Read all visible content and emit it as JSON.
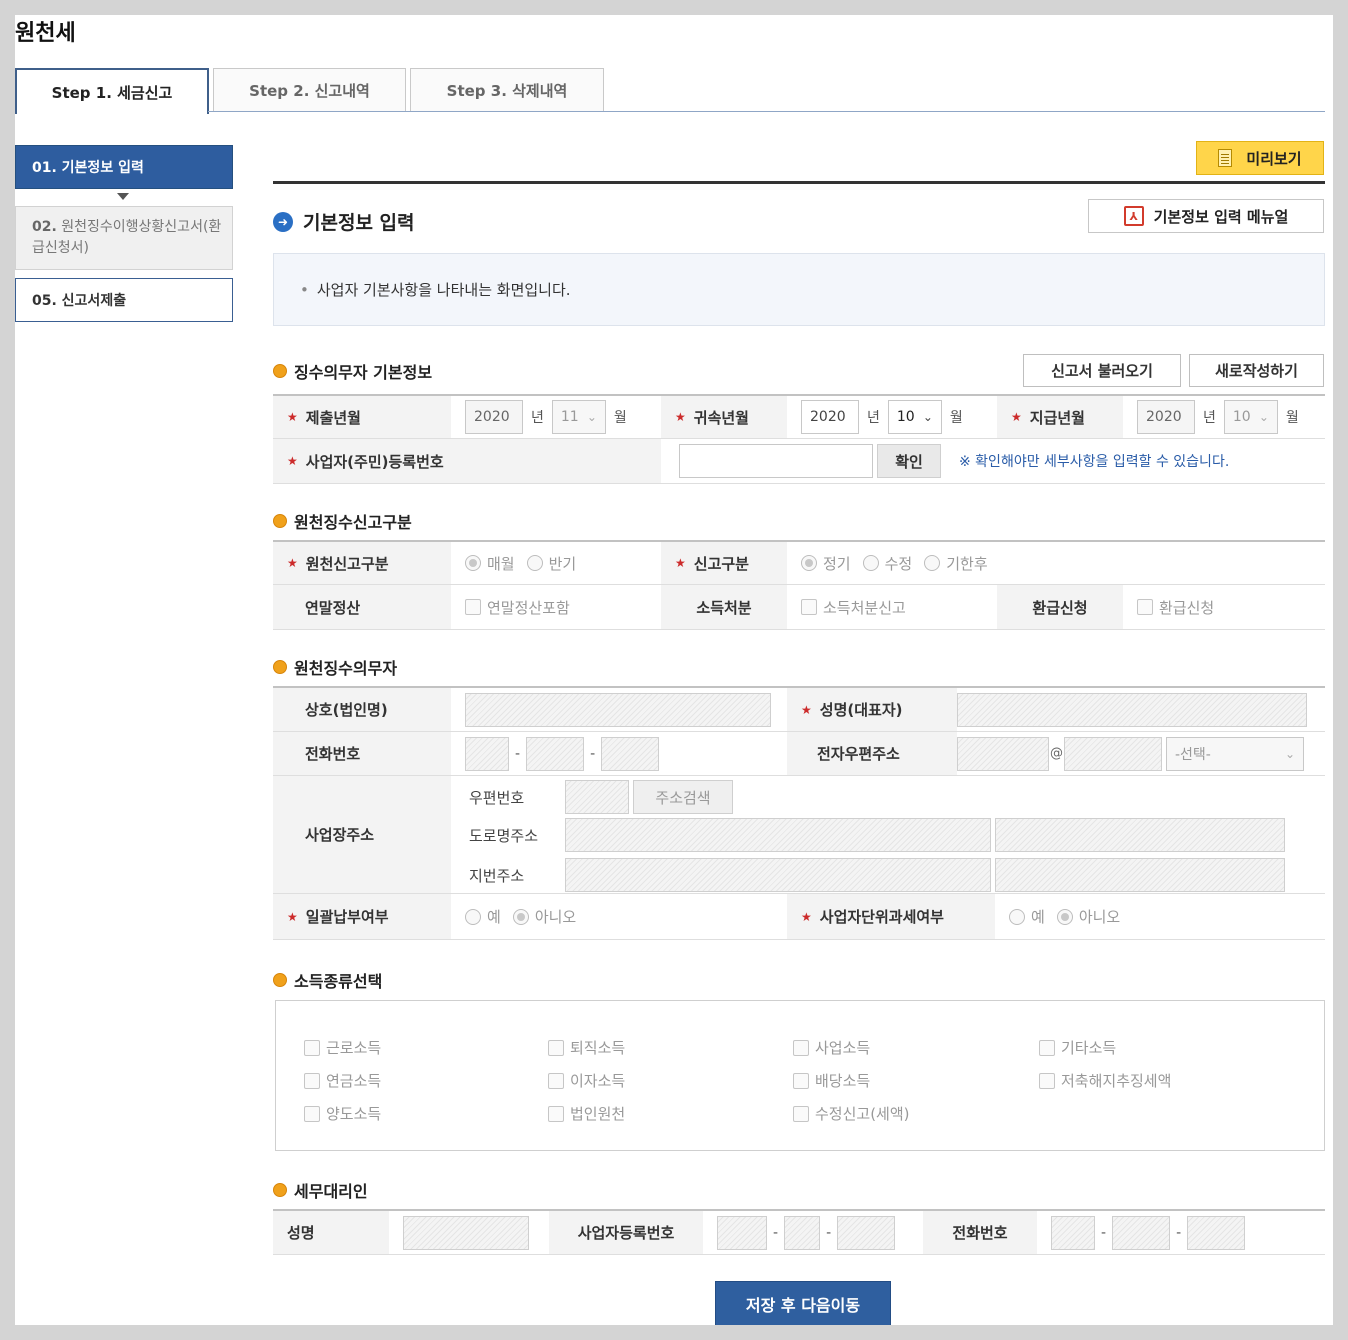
{
  "page": {
    "title": "원천세"
  },
  "tabs": [
    "Step 1. 세금신고",
    "Step 2. 신고내역",
    "Step 3. 삭제내역"
  ],
  "steps": {
    "s1": "01. 기본정보 입력",
    "s2_num": "02.",
    "s2_text": "원천징수이행상황신고서(환급신청서)",
    "s5": "05. 신고서제출"
  },
  "toolbar": {
    "preview": "미리보기",
    "manual": "기본정보 입력 메뉴얼"
  },
  "section": {
    "title": "기본정보 입력",
    "info": "사업자 기본사항을 나타내는 화면입니다."
  },
  "basic": {
    "title": "징수의무자 기본정보",
    "load_btn": "신고서 불러오기",
    "new_btn": "새로작성하기",
    "submit_label": "제출년월",
    "submit_year": "2020",
    "submit_month": "11",
    "attrib_label": "귀속년월",
    "attrib_year": "2020",
    "attrib_month": "10",
    "pay_label": "지급년월",
    "pay_year": "2020",
    "pay_month": "10",
    "year_unit": "년",
    "month_unit": "월",
    "reg_label": "사업자(주민)등록번호",
    "confirm_btn": "확인",
    "notice": "※ 확인해야만 세부사항을 입력할 수 있습니다."
  },
  "report": {
    "title": "원천징수신고구분",
    "type_label": "원천신고구분",
    "type_opt1": "매월",
    "type_opt2": "반기",
    "kind_label": "신고구분",
    "kind_opt1": "정기",
    "kind_opt2": "수정",
    "kind_opt3": "기한후",
    "yearend_label": "연말정산",
    "yearend_opt": "연말정산포함",
    "income_label": "소득처분",
    "income_opt": "소득처분신고",
    "refund_label": "환급신청",
    "refund_opt": "환급신청"
  },
  "agent": {
    "title": "원천징수의무자",
    "company_label": "상호(법인명)",
    "rep_label": "성명(대표자)",
    "phone_label": "전화번호",
    "email_label": "전자우편주소",
    "email_at": "@",
    "email_select": "-선택-",
    "addr_label": "사업장주소",
    "zip_label": "우편번호",
    "addr_btn": "주소검색",
    "road_label": "도로명주소",
    "lot_label": "지번주소",
    "bulk_label": "일괄납부여부",
    "bulk_yes": "예",
    "bulk_no": "아니오",
    "unit_label": "사업자단위과세여부",
    "unit_yes": "예",
    "unit_no": "아니오"
  },
  "income_types": {
    "title": "소득종류선택",
    "items": [
      "근로소득",
      "퇴직소득",
      "사업소득",
      "기타소득",
      "연금소득",
      "이자소득",
      "배당소득",
      "저축해지추징세액",
      "양도소득",
      "법인원천",
      "수정신고(세액)"
    ]
  },
  "tax_agent": {
    "title": "세무대리인",
    "name_label": "성명",
    "bizno_label": "사업자등록번호",
    "phone_label": "전화번호"
  },
  "footer": {
    "save_btn": "저장 후 다음이동"
  }
}
